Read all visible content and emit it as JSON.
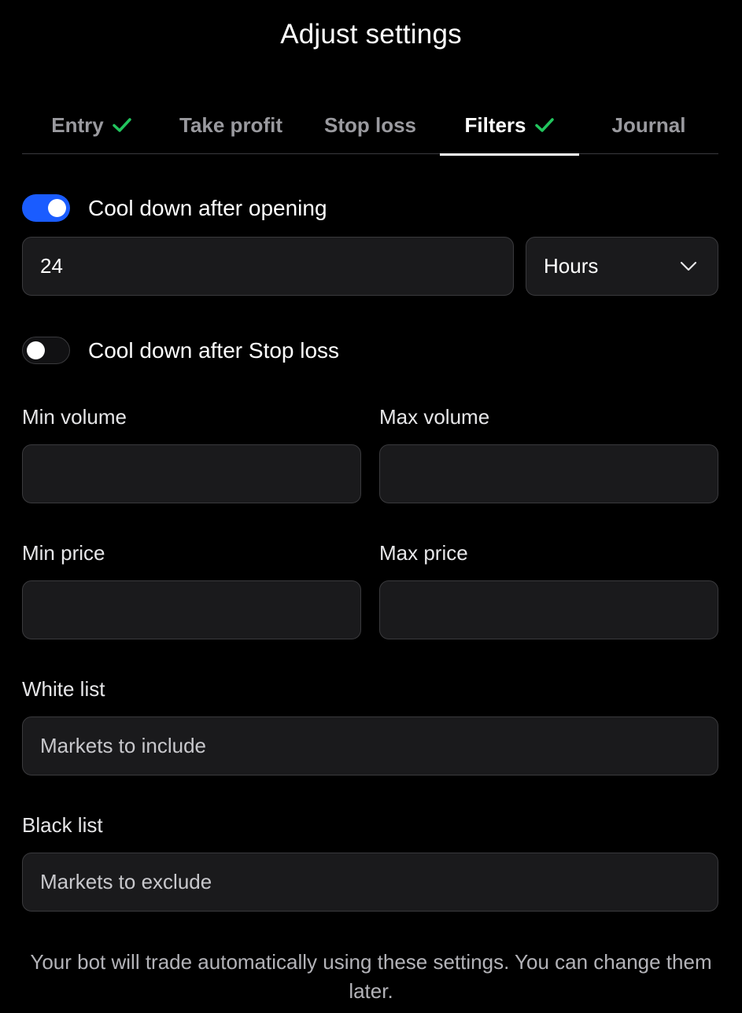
{
  "title": "Adjust settings",
  "tabs": [
    {
      "label": "Entry",
      "checked": true
    },
    {
      "label": "Take profit",
      "checked": false
    },
    {
      "label": "Stop loss",
      "checked": false
    },
    {
      "label": "Filters",
      "checked": true,
      "active": true
    },
    {
      "label": "Journal",
      "checked": false
    }
  ],
  "cooldown_opening": {
    "label": "Cool down after opening",
    "enabled": true,
    "value": "24",
    "unit": "Hours"
  },
  "cooldown_stoploss": {
    "label": "Cool down after Stop loss",
    "enabled": false
  },
  "min_volume": {
    "label": "Min volume",
    "value": ""
  },
  "max_volume": {
    "label": "Max volume",
    "value": ""
  },
  "min_price": {
    "label": "Min price",
    "value": ""
  },
  "max_price": {
    "label": "Max price",
    "value": ""
  },
  "white_list": {
    "label": "White list",
    "placeholder": "Markets to include"
  },
  "black_list": {
    "label": "Black list",
    "placeholder": "Markets to exclude"
  },
  "footer_text": "Your bot will trade automatically using these settings. You can change them later.",
  "colors": {
    "accent": "#1a5cff",
    "check": "#22c55e",
    "background": "#000000",
    "field_bg": "#1a1a1c"
  }
}
